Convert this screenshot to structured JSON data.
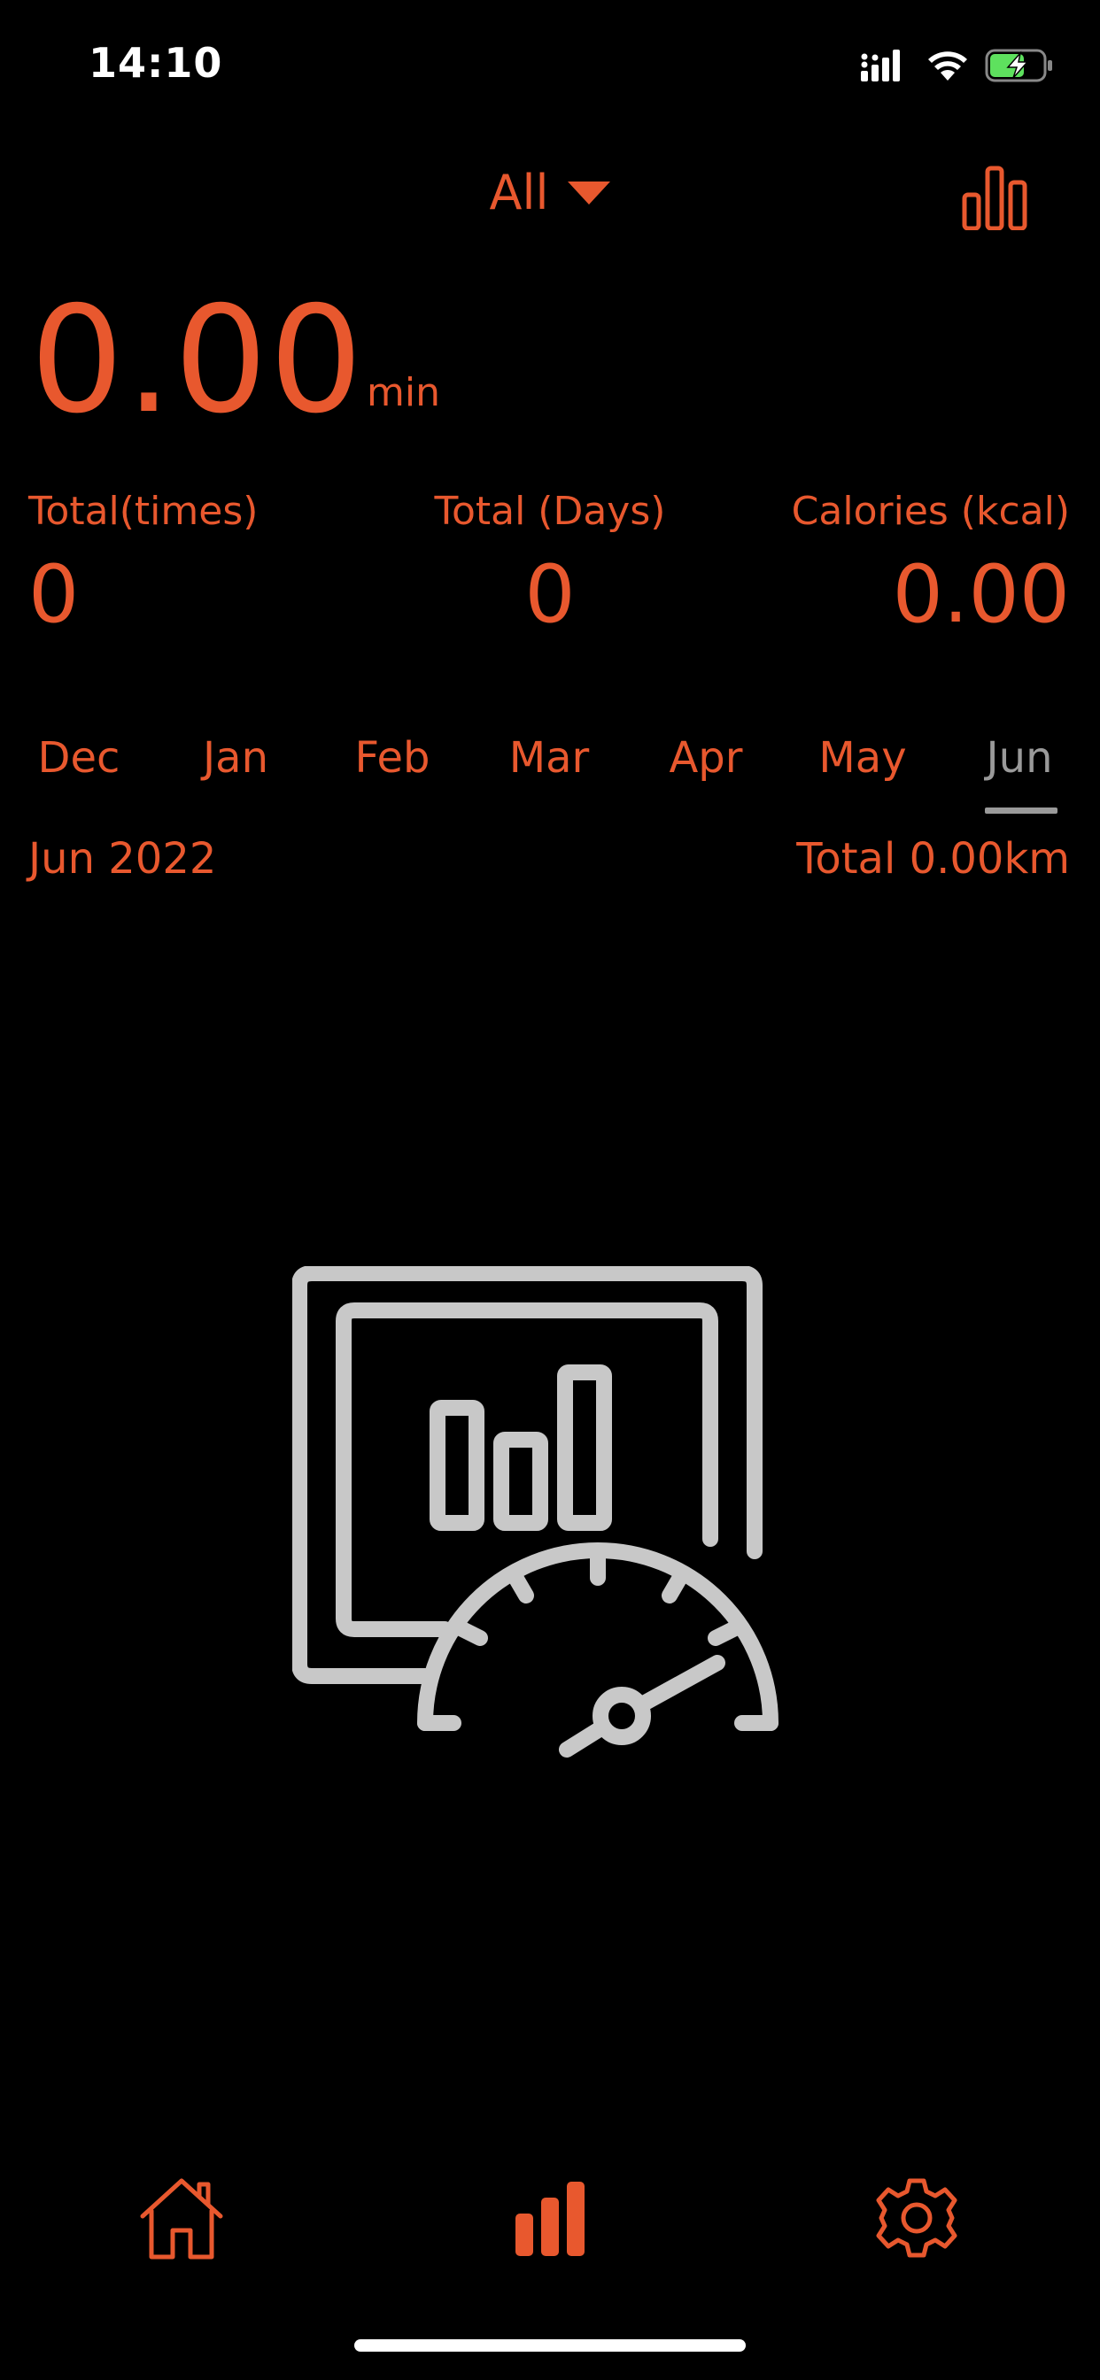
{
  "status_bar": {
    "time": "14:10"
  },
  "header": {
    "filter_label": "All",
    "filter_icon": "caret-down-icon",
    "stats_icon": "bar-chart-icon"
  },
  "summary": {
    "duration_value": "0.00",
    "duration_unit": "min",
    "total_times_label": "Total(times)",
    "total_times_value": "0",
    "total_days_label": "Total (Days)",
    "total_days_value": "0",
    "calories_label": "Calories (kcal)",
    "calories_value": "0.00"
  },
  "months": [
    "Dec",
    "Jan",
    "Feb",
    "Mar",
    "Apr",
    "May",
    "Jun"
  ],
  "selected_month": "Jun",
  "period": {
    "label": "Jun 2022",
    "total": "Total 0.00km"
  },
  "empty_state_icon": "dashboard-chart-gauge-icon",
  "tabbar": {
    "items": [
      {
        "icon": "home-icon",
        "name": "home"
      },
      {
        "icon": "bar-chart-icon",
        "name": "stats"
      },
      {
        "icon": "gear-icon",
        "name": "settings"
      }
    ]
  },
  "colors": {
    "accent": "#E8582E",
    "background": "#000000",
    "muted": "#9a9a9a",
    "illustration": "#c8c8c8"
  }
}
